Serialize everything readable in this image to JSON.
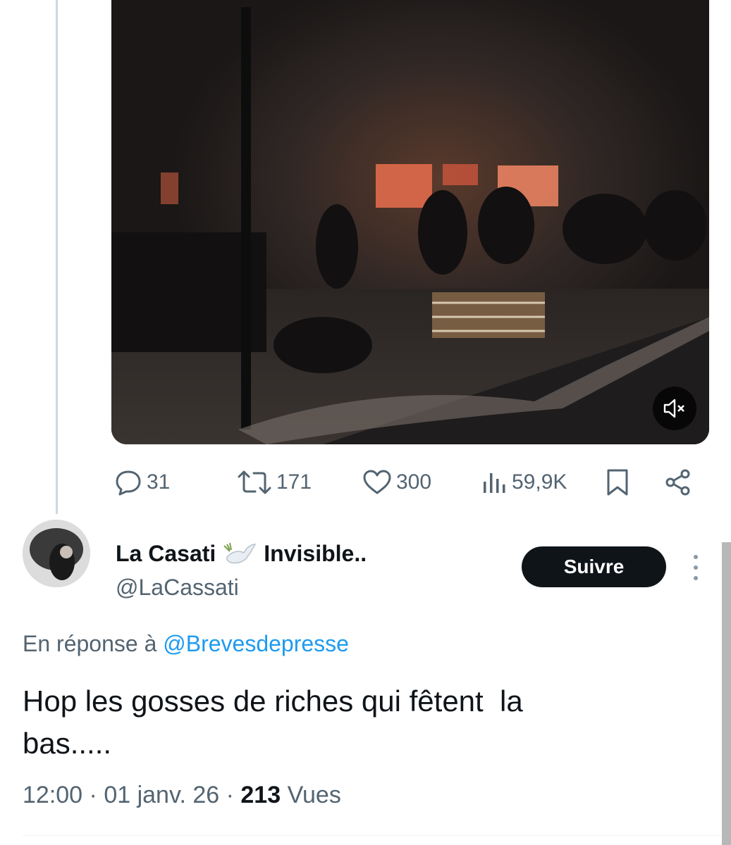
{
  "post": {
    "stats": {
      "replies": "31",
      "reposts": "171",
      "likes": "300",
      "views": "59,9K"
    }
  },
  "reply": {
    "display_name": "La Casati",
    "display_name_suffix": "Invisible..",
    "handle": "@LaCassati",
    "follow_label": "Suivre",
    "reply_prefix": "En réponse à",
    "reply_mention": "@Brevesdepresse",
    "text": "Hop les gosses de riches qui fêtent  la\nbas.....",
    "time": "12:00",
    "separator": "·",
    "date": "01 janv. 26",
    "views_count": "213",
    "views_label": "Vues"
  },
  "icons": {
    "reply": "reply-icon",
    "repost": "repost-icon",
    "like": "heart-icon",
    "views": "analytics-icon",
    "bookmark": "bookmark-icon",
    "share": "share-icon",
    "mute": "muted-speaker-icon",
    "dove": "dove-emoji-icon",
    "more": "more-vertical-icon"
  },
  "colors": {
    "text": "#0f1419",
    "secondary": "#536471",
    "link": "#1d9bf0",
    "button": "#0f1419"
  }
}
